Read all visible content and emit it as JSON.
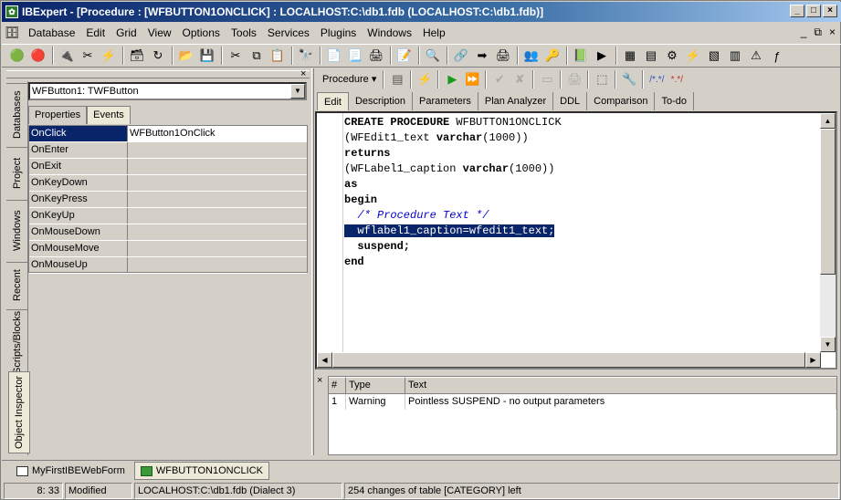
{
  "window": {
    "title": "IBExpert - [Procedure : [WFBUTTON1ONCLICK] : LOCALHOST:C:\\db1.fdb (LOCALHOST:C:\\db1.fdb)]"
  },
  "menu": [
    "Database",
    "Edit",
    "Grid",
    "View",
    "Options",
    "Tools",
    "Services",
    "Plugins",
    "Windows",
    "Help"
  ],
  "sidetabs": [
    "Object Inspector",
    "Scripts/Blocks",
    "Recent",
    "Windows",
    "Project",
    "Databases"
  ],
  "inspector": {
    "combo": "WFButton1: TWFButton",
    "tabs": [
      "Properties",
      "Events"
    ],
    "rows": [
      {
        "name": "OnClick",
        "value": "WFButton1OnClick"
      },
      {
        "name": "OnEnter",
        "value": ""
      },
      {
        "name": "OnExit",
        "value": ""
      },
      {
        "name": "OnKeyDown",
        "value": ""
      },
      {
        "name": "OnKeyPress",
        "value": ""
      },
      {
        "name": "OnKeyUp",
        "value": ""
      },
      {
        "name": "OnMouseDown",
        "value": ""
      },
      {
        "name": "OnMouseMove",
        "value": ""
      },
      {
        "name": "OnMouseUp",
        "value": ""
      }
    ]
  },
  "editor": {
    "dropdown": "Procedure",
    "tabs": [
      "Edit",
      "Description",
      "Parameters",
      "Plan Analyzer",
      "DDL",
      "Comparison",
      "To-do"
    ]
  },
  "code": {
    "l1_kw": "CREATE PROCEDURE",
    "l1_rest": " WFBUTTON1ONCLICK",
    "l2_a": "(WFEdit1_text ",
    "l2_kw": "varchar",
    "l2_b": "(1000))",
    "l3": "returns",
    "l4_a": "(WFLabel1_caption ",
    "l4_kw": "varchar",
    "l4_b": "(1000))",
    "l5": "as",
    "l6": "begin",
    "l7": "  /* Procedure Text */",
    "l8": "  wflabel1_caption=wfedit1_text;",
    "l9": "  suspend;",
    "l10": "end"
  },
  "messages": {
    "headers": [
      "#",
      "Type",
      "Text"
    ],
    "rows": [
      {
        "num": "1",
        "type": "Warning",
        "text": "Pointless SUSPEND - no output parameters"
      }
    ]
  },
  "doctabs": [
    "MyFirstIBEWebForm",
    "WFBUTTON1ONCLICK"
  ],
  "status": {
    "pos": "8:  33",
    "state": "Modified",
    "db": "LOCALHOST:C:\\db1.fdb (Dialect 3)",
    "info": "254 changes of table [CATEGORY] left"
  }
}
